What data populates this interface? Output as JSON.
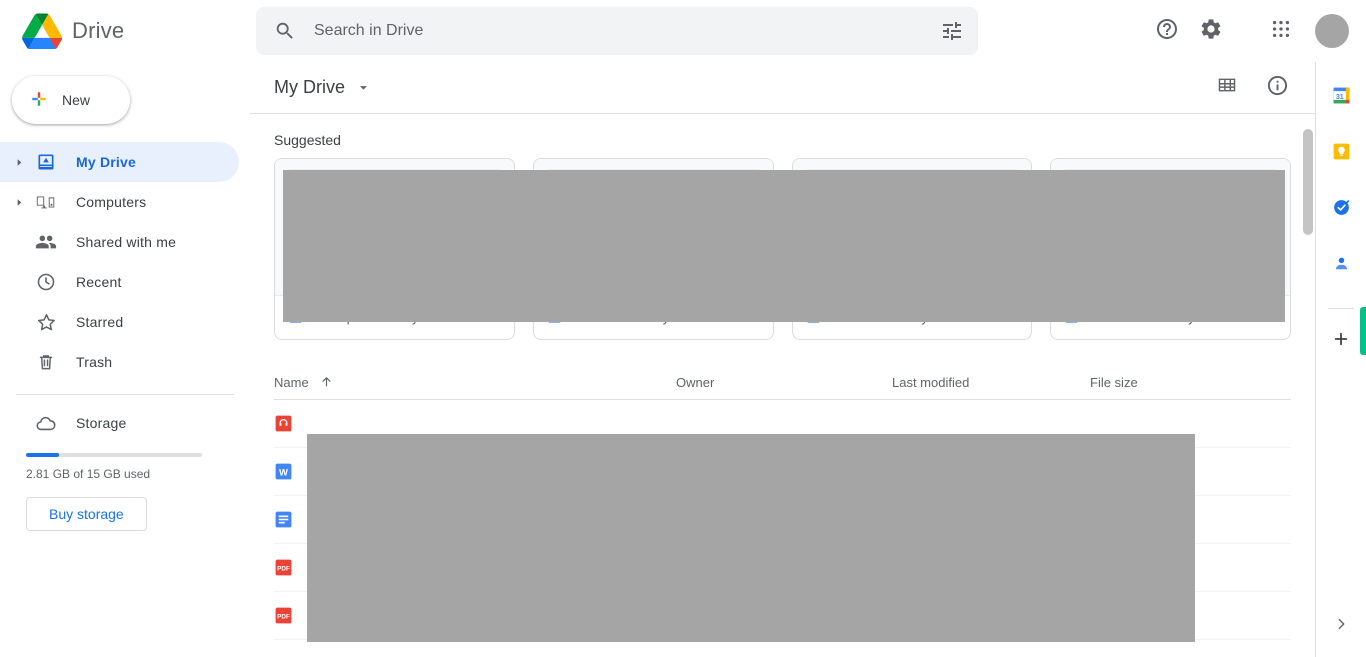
{
  "app": {
    "brand_name": "Drive",
    "logo_icon": "google-drive-logo"
  },
  "search": {
    "placeholder": "Search in Drive",
    "value": "",
    "search_icon": "search-icon",
    "filter_icon": "tune-icon"
  },
  "topbar_actions": [
    {
      "name": "help",
      "icon": "help-circle-icon",
      "label": "Support"
    },
    {
      "name": "settings",
      "icon": "gear-icon",
      "label": "Settings"
    },
    {
      "name": "apps",
      "icon": "apps-grid-icon",
      "label": "Google apps"
    },
    {
      "name": "account",
      "icon": "avatar",
      "label": "Google Account"
    }
  ],
  "sidebar": {
    "new_button": {
      "label": "New",
      "icon": "plus-colored-icon"
    },
    "items": [
      {
        "label": "My Drive",
        "icon": "drive-folder-icon",
        "active": true,
        "expandable": true
      },
      {
        "label": "Computers",
        "icon": "computer-icon",
        "active": false,
        "expandable": true
      },
      {
        "label": "Shared with me",
        "icon": "people-icon",
        "active": false,
        "expandable": false
      },
      {
        "label": "Recent",
        "icon": "clock-icon",
        "active": false,
        "expandable": false
      },
      {
        "label": "Starred",
        "icon": "star-icon",
        "active": false,
        "expandable": false
      },
      {
        "label": "Trash",
        "icon": "trash-icon",
        "active": false,
        "expandable": false
      }
    ],
    "storage": {
      "label": "Storage",
      "icon": "cloud-icon",
      "used_text": "2.81 GB of 15 GB used",
      "percent_used": 18.7,
      "buy_label": "Buy storage",
      "bar_color": "#1a73e8"
    }
  },
  "main": {
    "breadcrumb_title": "My Drive",
    "breadcrumb_caret_icon": "chevron-down-icon",
    "view_toggle_icon": "grid-view-icon",
    "details_icon": "info-circle-icon",
    "suggested_label": "Suggested",
    "suggested_cards": [
      {
        "subtitle": "You opened today",
        "icon": "google-docs-icon"
      },
      {
        "subtitle": "You edited today",
        "icon": "google-docs-icon"
      },
      {
        "subtitle": "You edited today",
        "icon": "google-docs-icon"
      },
      {
        "subtitle": "You created today",
        "icon": "google-docs-icon"
      }
    ],
    "table": {
      "columns": [
        {
          "label": "Name",
          "sorted": true,
          "sort_icon": "arrow-up-icon"
        },
        {
          "label": "Owner",
          "sorted": false
        },
        {
          "label": "Last modified",
          "sorted": false
        },
        {
          "label": "File size",
          "sorted": false
        }
      ],
      "rows": [
        {
          "icon": "audio-file-icon",
          "name": "",
          "owner": "",
          "last_modified": "",
          "file_size": ""
        },
        {
          "icon": "word-file-icon",
          "name": "",
          "owner": "",
          "last_modified": "",
          "file_size": ""
        },
        {
          "icon": "google-docs-icon",
          "name": "",
          "owner": "",
          "last_modified": "",
          "file_size": ""
        },
        {
          "icon": "pdf-file-icon",
          "name": "",
          "owner": "",
          "last_modified": "",
          "file_size": ""
        },
        {
          "icon": "pdf-file-icon",
          "name": "",
          "owner": "",
          "last_modified": "",
          "file_size": ""
        }
      ]
    }
  },
  "side_rail": {
    "apps": [
      {
        "name": "calendar",
        "icon": "google-calendar-icon",
        "badge": "31"
      },
      {
        "name": "keep",
        "icon": "google-keep-icon",
        "badge": ""
      },
      {
        "name": "tasks",
        "icon": "google-tasks-icon",
        "badge": ""
      },
      {
        "name": "contacts",
        "icon": "google-contacts-icon",
        "badge": ""
      }
    ],
    "add_label": "Get add-ons",
    "add_icon": "plus-icon",
    "expand_icon": "chevron-right-icon"
  },
  "colors": {
    "accent_blue": "#1a73e8",
    "active_blue_text": "#1967d2",
    "active_blue_bg": "#e8f0fe",
    "text_primary": "#3c4043",
    "text_secondary": "#5f6368",
    "border": "#e0e0e0",
    "redaction_gray": "#a5a5a5",
    "green_tab": "#00c38a"
  }
}
